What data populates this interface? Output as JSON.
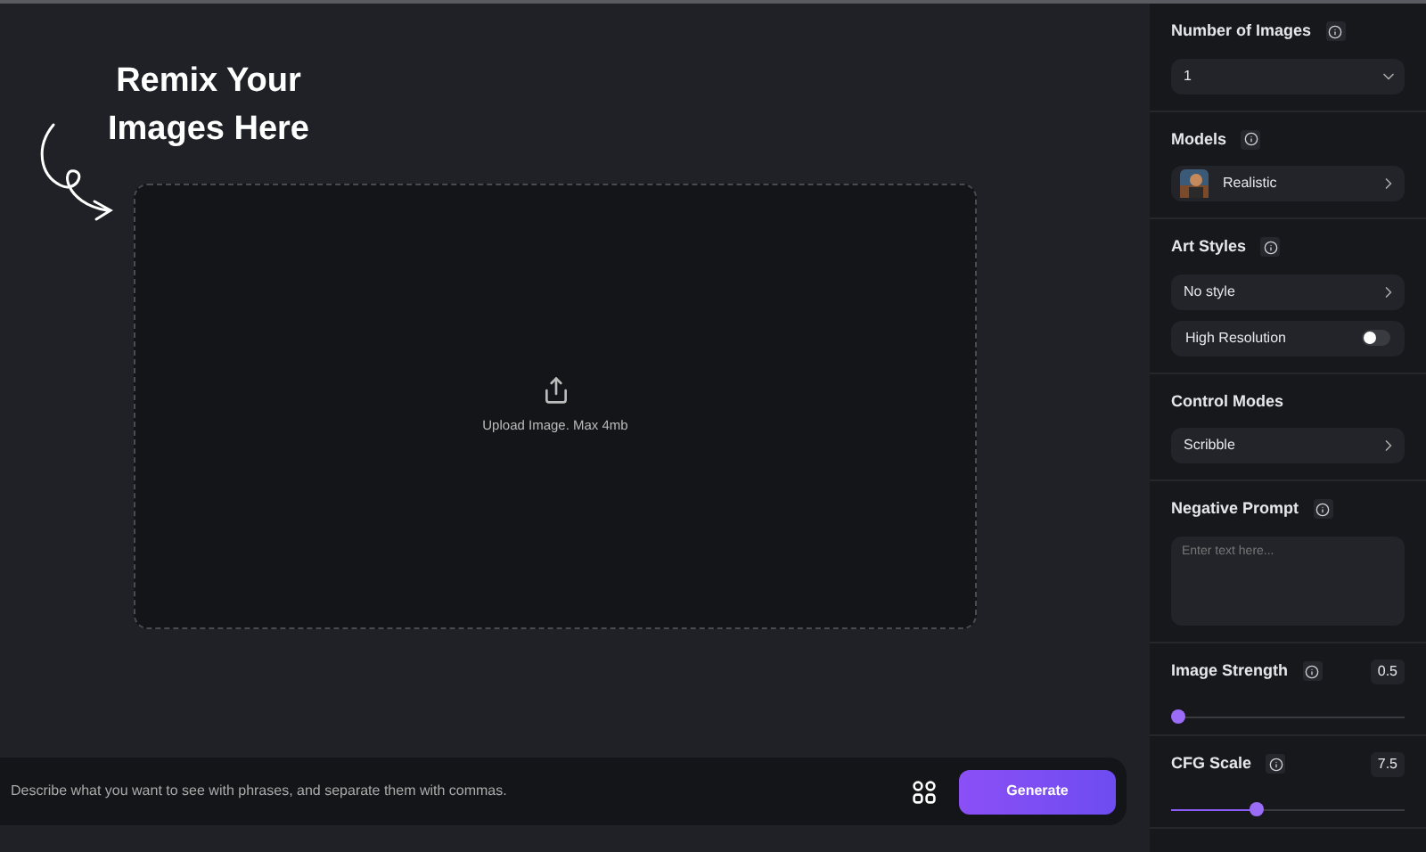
{
  "heading": {
    "line_1": "Remix Your",
    "line_2": "Images Here"
  },
  "upload": {
    "label": "Upload Image. Max 4mb"
  },
  "prompt": {
    "placeholder": "Describe what you want to see with phrases, and separate them with commas.",
    "generate_button": "Generate"
  },
  "sidebar": {
    "sections": [
      {
        "kind": "select",
        "title": "Number of Images",
        "value": "1"
      },
      {
        "kind": "model",
        "title": "Models",
        "value": "Realistic"
      },
      {
        "kind": "styles",
        "title": "Art Styles",
        "value": "No style",
        "toggle": {
          "label": "High Resolution",
          "on": false
        }
      },
      {
        "kind": "nav",
        "title": "Control Modes",
        "value": "Scribble"
      },
      {
        "kind": "textarea",
        "title": "Negative Prompt",
        "placeholder": "Enter text here..."
      },
      {
        "kind": "slider",
        "title": "Image Strength",
        "reading": "0.5",
        "level": 0
      },
      {
        "kind": "slider",
        "title": "CFG Scale",
        "reading": "7.5",
        "level": 0.36
      }
    ]
  }
}
